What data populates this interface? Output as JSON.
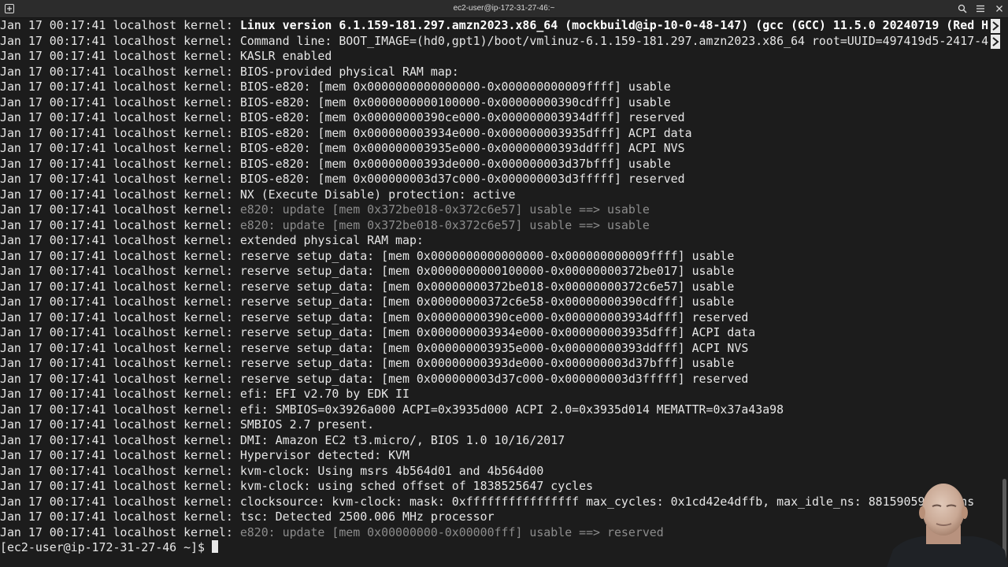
{
  "window": {
    "title": "ec2-user@ip-172-31-27-46:~",
    "icons": [
      "new-tab-icon",
      "search-icon",
      "hamburger-menu-icon",
      "close-icon"
    ]
  },
  "terminal": {
    "line_prefix": "Jan 17 00:17:41 localhost kernel: ",
    "lines": [
      {
        "msg": "Linux version 6.1.159-181.297.amzn2023.x86_64 (mockbuild@ip-10-0-48-147) (gcc (GCC) 11.5.0 20240719 (Red H",
        "style": "bold",
        "truncated": true
      },
      {
        "msg": "Command line: BOOT_IMAGE=(hd0,gpt1)/boot/vmlinuz-6.1.159-181.297.amzn2023.x86_64 root=UUID=497419d5-2417-4",
        "style": "normal",
        "truncated": true
      },
      {
        "msg": "KASLR enabled",
        "style": "normal"
      },
      {
        "msg": "BIOS-provided physical RAM map:",
        "style": "normal"
      },
      {
        "msg": "BIOS-e820: [mem 0x0000000000000000-0x000000000009ffff] usable",
        "style": "normal"
      },
      {
        "msg": "BIOS-e820: [mem 0x0000000000100000-0x00000000390cdfff] usable",
        "style": "normal"
      },
      {
        "msg": "BIOS-e820: [mem 0x00000000390ce000-0x000000003934dfff] reserved",
        "style": "normal"
      },
      {
        "msg": "BIOS-e820: [mem 0x000000003934e000-0x000000003935dfff] ACPI data",
        "style": "normal"
      },
      {
        "msg": "BIOS-e820: [mem 0x000000003935e000-0x00000000393ddfff] ACPI NVS",
        "style": "normal"
      },
      {
        "msg": "BIOS-e820: [mem 0x00000000393de000-0x000000003d37bfff] usable",
        "style": "normal"
      },
      {
        "msg": "BIOS-e820: [mem 0x000000003d37c000-0x000000003d3fffff] reserved",
        "style": "normal"
      },
      {
        "msg": "NX (Execute Disable) protection: active",
        "style": "normal"
      },
      {
        "msg": "e820: update [mem 0x372be018-0x372c6e57] usable ==> usable",
        "style": "dim"
      },
      {
        "msg": "e820: update [mem 0x372be018-0x372c6e57] usable ==> usable",
        "style": "dim"
      },
      {
        "msg": "extended physical RAM map:",
        "style": "normal"
      },
      {
        "msg": "reserve setup_data: [mem 0x0000000000000000-0x000000000009ffff] usable",
        "style": "normal"
      },
      {
        "msg": "reserve setup_data: [mem 0x0000000000100000-0x00000000372be017] usable",
        "style": "normal"
      },
      {
        "msg": "reserve setup_data: [mem 0x00000000372be018-0x00000000372c6e57] usable",
        "style": "normal"
      },
      {
        "msg": "reserve setup_data: [mem 0x00000000372c6e58-0x00000000390cdfff] usable",
        "style": "normal"
      },
      {
        "msg": "reserve setup_data: [mem 0x00000000390ce000-0x000000003934dfff] reserved",
        "style": "normal"
      },
      {
        "msg": "reserve setup_data: [mem 0x000000003934e000-0x000000003935dfff] ACPI data",
        "style": "normal"
      },
      {
        "msg": "reserve setup_data: [mem 0x000000003935e000-0x00000000393ddfff] ACPI NVS",
        "style": "normal"
      },
      {
        "msg": "reserve setup_data: [mem 0x00000000393de000-0x000000003d37bfff] usable",
        "style": "normal"
      },
      {
        "msg": "reserve setup_data: [mem 0x000000003d37c000-0x000000003d3fffff] reserved",
        "style": "normal"
      },
      {
        "msg": "efi: EFI v2.70 by EDK II",
        "style": "normal"
      },
      {
        "msg": "efi: SMBIOS=0x3926a000 ACPI=0x3935d000 ACPI 2.0=0x3935d014 MEMATTR=0x37a43a98",
        "style": "normal"
      },
      {
        "msg": "SMBIOS 2.7 present.",
        "style": "normal"
      },
      {
        "msg": "DMI: Amazon EC2 t3.micro/, BIOS 1.0 10/16/2017",
        "style": "normal"
      },
      {
        "msg": "Hypervisor detected: KVM",
        "style": "normal"
      },
      {
        "msg": "kvm-clock: Using msrs 4b564d01 and 4b564d00",
        "style": "normal"
      },
      {
        "msg": "kvm-clock: using sched offset of 1838525647 cycles",
        "style": "normal"
      },
      {
        "msg": "clocksource: kvm-clock: mask: 0xffffffffffffffff max_cycles: 0x1cd42e4dffb, max_idle_ns: 881590591483 ns",
        "style": "normal"
      },
      {
        "msg": "tsc: Detected 2500.006 MHz processor",
        "style": "normal"
      },
      {
        "msg": "e820: update [mem 0x00000000-0x00000fff] usable ==> reserved",
        "style": "dim"
      }
    ],
    "prompt": "[ec2-user@ip-172-31-27-46 ~]$ "
  },
  "colors": {
    "background": "#1c1c1c",
    "text": "#e6e6e6",
    "bold_text": "#ffffff",
    "dim_text": "#8c8c8c",
    "titlebar": "#2c2c2c"
  }
}
